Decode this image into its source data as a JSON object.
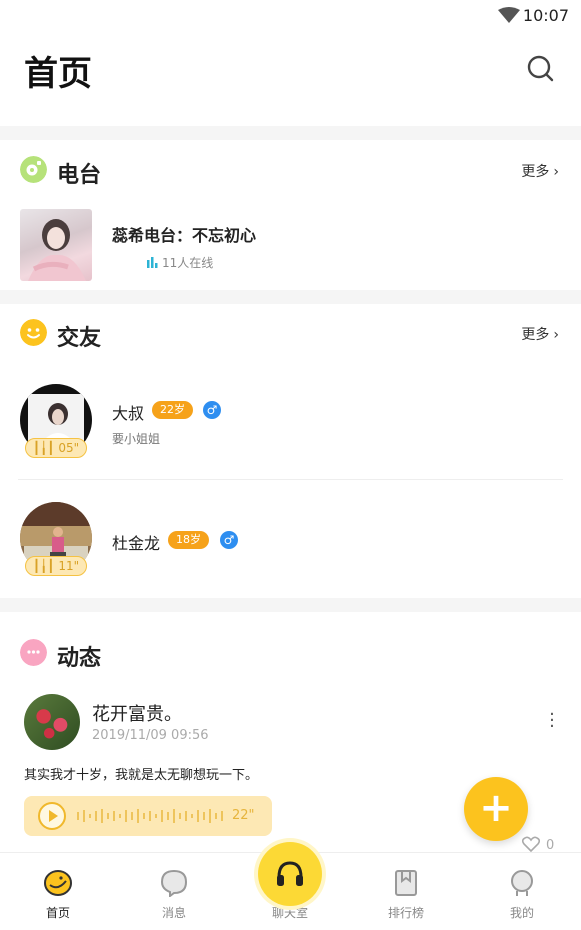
{
  "status_bar": {
    "time": "10:07"
  },
  "header": {
    "title": "首页"
  },
  "radio": {
    "title": "电台",
    "more_label": "更多",
    "item": {
      "name": "蕊希电台：不忘初心",
      "online": "11人在线"
    }
  },
  "friends": {
    "title": "交友",
    "more_label": "更多",
    "items": [
      {
        "name": "大叔",
        "age": "22岁",
        "gender": "♂",
        "signature": "要小姐姐",
        "voice_duration": "05\""
      },
      {
        "name": "杜金龙",
        "age": "18岁",
        "gender": "♂",
        "signature": "",
        "voice_duration": "11\""
      }
    ]
  },
  "moments": {
    "title": "动态",
    "post": {
      "author": "花开富贵。",
      "time": "2019/11/09 09:56",
      "text": "其实我才十岁，我就是太无聊想玩一下。",
      "voice_duration": "22\"",
      "likes": "0"
    }
  },
  "tabbar": {
    "items": [
      {
        "label": "首页",
        "icon": "home-smile-icon",
        "active": true
      },
      {
        "label": "消息",
        "icon": "message-bubble-icon",
        "active": false
      },
      {
        "label": "聊天室",
        "icon": "headphones-icon",
        "active": false
      },
      {
        "label": "排行榜",
        "icon": "ranking-bookmark-icon",
        "active": false
      },
      {
        "label": "我的",
        "icon": "profile-icon",
        "active": false
      }
    ]
  },
  "colors": {
    "accent": "#fcc31e",
    "age_badge": "#f6a21a",
    "gender_male": "#2e8ef0",
    "voice_bg": "#fde8b4"
  }
}
